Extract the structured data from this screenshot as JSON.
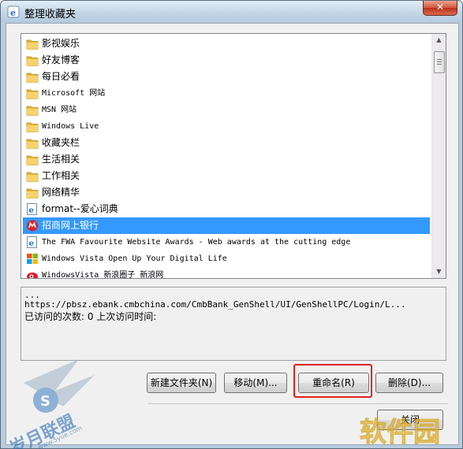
{
  "window": {
    "title": "整理收藏夹",
    "close_label": "✕"
  },
  "favorites": [
    {
      "label": "影视娱乐",
      "icon": "folder-icon",
      "mono": false
    },
    {
      "label": "好友博客",
      "icon": "folder-icon",
      "mono": false
    },
    {
      "label": "每日必看",
      "icon": "folder-icon",
      "mono": false
    },
    {
      "label": "Microsoft 网站",
      "icon": "folder-icon",
      "mono": true
    },
    {
      "label": "MSN 网站",
      "icon": "folder-icon",
      "mono": true
    },
    {
      "label": "Windows Live",
      "icon": "folder-icon",
      "mono": true
    },
    {
      "label": "收藏夹栏",
      "icon": "folder-icon",
      "mono": false
    },
    {
      "label": "生活相关",
      "icon": "folder-icon",
      "mono": false
    },
    {
      "label": "工作相关",
      "icon": "folder-icon",
      "mono": false
    },
    {
      "label": "网络精华",
      "icon": "folder-icon",
      "mono": false
    },
    {
      "label": "format--爱心词典",
      "icon": "ie-page-icon",
      "mono": false
    },
    {
      "label": "招商网上银行",
      "icon": "cmb-bank-icon",
      "mono": false,
      "selected": true
    },
    {
      "label": "The FWA Favourite Website Awards - Web awards at the cutting edge",
      "icon": "ie-page-icon",
      "mono": true
    },
    {
      "label": "Windows Vista Open Up Your Digital Life",
      "icon": "windows-flag-icon",
      "mono": true
    },
    {
      "label": "WindowsVista_新浪圈子_新浪网",
      "icon": "sina-icon",
      "mono": true
    }
  ],
  "details": {
    "line1": "...",
    "url": "https://pbsz.ebank.cmbchina.com/CmbBank_GenShell/UI/GenShellPC/Login/L...",
    "visits": "已访问的次数: 0    上次访问时间:"
  },
  "buttons": {
    "new_folder": "新建文件夹(N)",
    "move": "移动(M)...",
    "rename": "重命名(R)",
    "delete": "删除(D)...",
    "close": "关闭"
  },
  "watermark": {
    "left_text": "岁月联盟",
    "left_url": "www.5yue.com",
    "right_text": "软件园"
  },
  "colors": {
    "selection": "#3399ff",
    "highlight": "#e02020",
    "folder": "#f2c24c"
  }
}
